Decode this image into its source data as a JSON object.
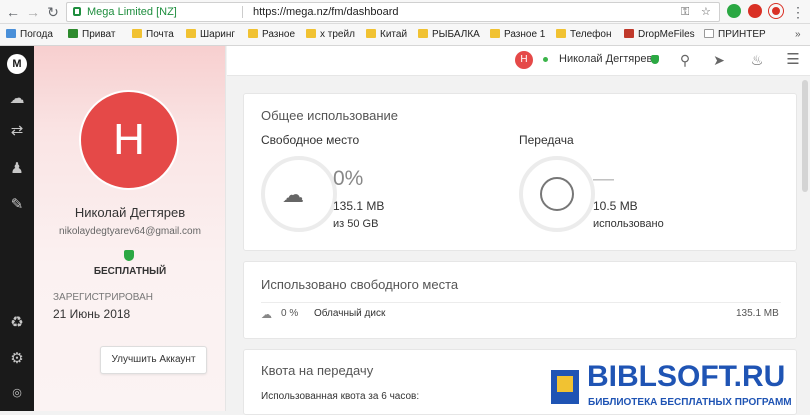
{
  "browser": {
    "secure_label": "Mega Limited [NZ]",
    "url": "https://mega.nz/fm/dashboard"
  },
  "bookmarks": [
    {
      "label": "Погода",
      "icon": "weather-icon"
    },
    {
      "label": "Приват",
      "icon": "privat-icon"
    },
    {
      "label": "Почта",
      "icon": "folder-icon"
    },
    {
      "label": "Шаринг",
      "icon": "folder-icon"
    },
    {
      "label": "Разное",
      "icon": "folder-icon"
    },
    {
      "label": "х трейл",
      "icon": "folder-icon"
    },
    {
      "label": "Китай",
      "icon": "folder-icon"
    },
    {
      "label": "РЫБАЛКА",
      "icon": "folder-icon"
    },
    {
      "label": "Разное 1",
      "icon": "folder-icon"
    },
    {
      "label": "Телефон",
      "icon": "folder-icon"
    },
    {
      "label": "DropMeFiles",
      "icon": "dropmefiles-icon"
    },
    {
      "label": "ПРИНТЕР",
      "icon": "page-icon"
    }
  ],
  "sidebar": {
    "logo": "M",
    "items": [
      "cloud-icon",
      "transfers-icon",
      "contacts-icon",
      "chat-icon",
      "rubbish-bin-icon",
      "settings-icon"
    ]
  },
  "profile": {
    "initial": "Н",
    "name": "Николай Дегтярев",
    "email": "nikolaydegtyarev64@gmail.com",
    "plan": "БЕСПЛАТНЫЙ",
    "registered_label": "ЗАРЕГИСТРИРОВАН",
    "registered_date": "21 Июнь 2018",
    "upgrade_label": "Улучшить Аккаунт"
  },
  "topbar": {
    "initial": "Н",
    "user_name": "Николай Дегтярев"
  },
  "usage": {
    "title": "Общее использование",
    "storage": {
      "title": "Свободное место",
      "percent": "0%",
      "used": "135.1 MB",
      "of_total": "из 50 GB"
    },
    "transfer": {
      "title": "Передача",
      "dash": "—",
      "used": "10.5 MB",
      "used_label": "использовано"
    }
  },
  "space_used": {
    "title": "Использовано свободного места",
    "row": {
      "percent": "0 %",
      "label": "Облачный диск",
      "size": "135.1 MB"
    }
  },
  "quota": {
    "title": "Квота на передачу",
    "row_label": "Использованная квота за 6 часов:"
  },
  "watermark": {
    "title": "BIBLSOFT.RU",
    "subtitle": "БИБЛИОТЕКА БЕСПЛАТНЫХ ПРОГРАММ"
  },
  "colors": {
    "accent": "#e54948",
    "online": "#3bb44a",
    "shield": "#2ba843",
    "watermark": "#1f54b4"
  }
}
